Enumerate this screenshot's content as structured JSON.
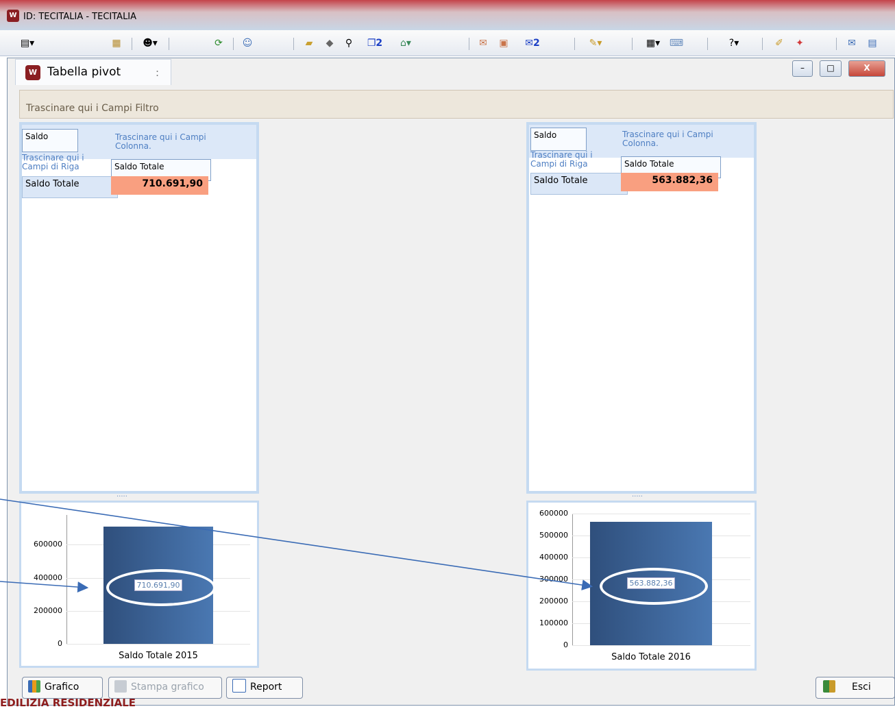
{
  "window": {
    "title": "ID: TECITALIA - TECITALIA",
    "tab_title": "Tabella pivot",
    "tab_menu": ":",
    "minimize": "–",
    "maximize": "□",
    "close": "X"
  },
  "toolbar": {
    "badge_copy": "2",
    "badge_mail": "2"
  },
  "filter_zone": "Trascinare qui i Campi Filtro",
  "pivots": [
    {
      "field": "Saldo",
      "column_hint": "Trascinare qui i Campi Colonna.",
      "row_hint": "Trascinare qui i Campi di Riga",
      "column_header": "Saldo Totale",
      "row_header": "Saldo Totale",
      "value": "710.691,90"
    },
    {
      "field": "Saldo",
      "column_hint": "Trascinare qui i Campi Colonna.",
      "row_hint": "Trascinare qui i Campi di Riga",
      "column_header": "Saldo Totale",
      "row_header": "Saldo Totale",
      "value": "563.882,36"
    }
  ],
  "splitter": ".....",
  "chart_data": [
    {
      "type": "bar",
      "categories": [
        "Saldo Totale 2015"
      ],
      "values": [
        710691.9
      ],
      "data_labels": [
        "710.691,90"
      ],
      "yticks": [
        "0",
        "200000",
        "400000",
        "600000"
      ],
      "ylim": [
        0,
        780000
      ]
    },
    {
      "type": "bar",
      "categories": [
        "Saldo Totale 2016"
      ],
      "values": [
        563882.36
      ],
      "data_labels": [
        "563.882,36"
      ],
      "yticks": [
        "0",
        "100000",
        "200000",
        "300000",
        "400000",
        "500000",
        "600000"
      ],
      "ylim": [
        0,
        600000
      ]
    }
  ],
  "buttons": {
    "grafico": "Grafico",
    "stampa": "Stampa grafico",
    "report": "Report",
    "esci": "Esci"
  },
  "footer": "EDILIZIA RESIDENZIALE",
  "colors": {
    "accent_cell": "#f99f80",
    "bar": "#3d6398",
    "arrow": "#3a6bb5"
  }
}
